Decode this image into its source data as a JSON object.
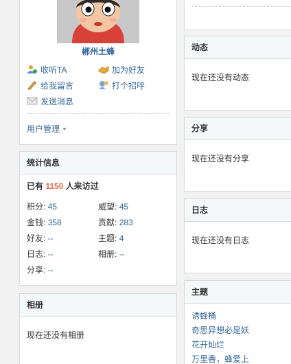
{
  "profile": {
    "username": "郴州土蜂",
    "actions": [
      {
        "label": "收听TA",
        "icon": "follow-icon"
      },
      {
        "label": "加为好友",
        "icon": "add-friend-icon"
      },
      {
        "label": "给我留言",
        "icon": "pencil-icon"
      },
      {
        "label": "打个招呼",
        "icon": "greet-icon"
      },
      {
        "label": "发送消息",
        "icon": "envelope-icon"
      }
    ],
    "manage_label": "用户管理"
  },
  "stats": {
    "title": "统计信息",
    "visits_prefix": "已有",
    "visits_count": "1150",
    "visits_suffix": "人来访过",
    "items": [
      {
        "label": "积分:",
        "value": "45"
      },
      {
        "label": "威望:",
        "value": "45"
      },
      {
        "label": "金钱:",
        "value": "358"
      },
      {
        "label": "贡献:",
        "value": "283"
      },
      {
        "label": "好友:",
        "value": "--"
      },
      {
        "label": "主题:",
        "value": "4"
      },
      {
        "label": "日志:",
        "value": "--"
      },
      {
        "label": "相册:",
        "value": "--"
      },
      {
        "label": "分享:",
        "value": "--"
      }
    ]
  },
  "album": {
    "title": "相册",
    "empty": "现在还没有相册"
  },
  "dynamic": {
    "title": "动态",
    "empty": "现在还没有动态"
  },
  "share": {
    "title": "分享",
    "empty": "现在还没有分享"
  },
  "log": {
    "title": "日志",
    "empty": "现在还没有日志"
  },
  "topics": {
    "title": "主题",
    "items": [
      "诱蜂桶",
      "奇思异想必是妖",
      "花开灿烂",
      "万里香，蜂爱上"
    ]
  },
  "colors": {
    "link": "#336699",
    "accent": "#e46b42",
    "border": "#d9d9d9"
  }
}
